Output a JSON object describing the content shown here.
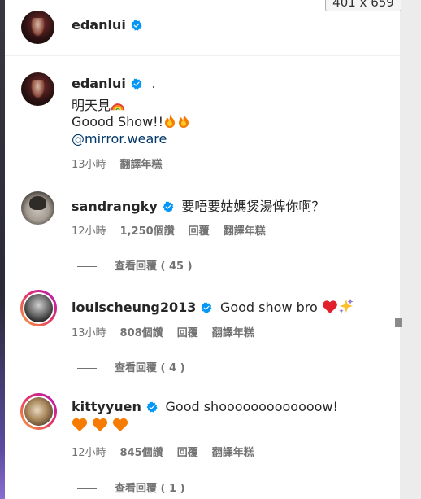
{
  "overlay": {
    "dimensions_label": "401 x 659"
  },
  "header": {
    "username": "edanlui"
  },
  "post": {
    "username": "edanlui",
    "dot": ".",
    "line1": "明天見",
    "line2": "Goood Show!!",
    "mention": "@mirror.weare",
    "time": "13小時",
    "translate": "翻譯年糕"
  },
  "comments": [
    {
      "username": "sandrangky",
      "text": "要唔要姑媽煲湯俾你啊？",
      "time": "12小時",
      "likes": "1,250個讚",
      "reply": "回覆",
      "translate": "翻譯年糕",
      "view_replies": "查看回覆 ( 45 )"
    },
    {
      "username": "louischeung2013",
      "text": "Good show bro",
      "time": "13小時",
      "likes": "808個讚",
      "reply": "回覆",
      "translate": "翻譯年糕",
      "view_replies": "查看回覆 ( 4 )"
    },
    {
      "username": "kittyyuen",
      "text": "Good shooooooooooooow!",
      "time": "12小時",
      "likes": "845個讚",
      "reply": "回覆",
      "translate": "翻譯年糕",
      "view_replies": "查看回覆 ( 1 )"
    }
  ],
  "icons": {
    "verified": "verified-badge-icon",
    "rainbow": "rainbow-icon",
    "fire": "fire-icon",
    "heart_red": "red-heart-icon",
    "heart_orange": "orange-heart-icon",
    "sparkles": "sparkles-icon"
  },
  "colors": {
    "verified_blue": "#0095f6",
    "mention": "#00376b",
    "meta_gray": "#737373"
  }
}
